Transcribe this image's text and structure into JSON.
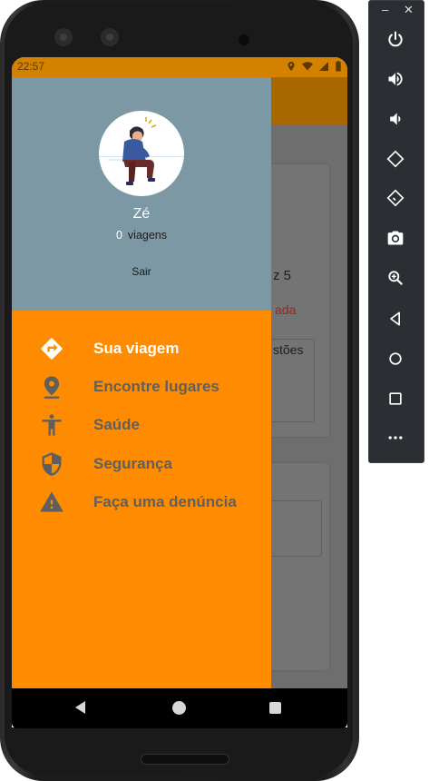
{
  "status_bar": {
    "time": "22:57"
  },
  "background_app": {
    "fragments": [
      "z 5",
      "ada",
      "stões"
    ]
  },
  "drawer": {
    "user_name": "Zé",
    "trip_count": "0",
    "trips_label": "viagens",
    "logout_label": "Sair",
    "menu": [
      {
        "label": "Sua viagem",
        "icon": "directions-icon",
        "active": true
      },
      {
        "label": "Encontre lugares",
        "icon": "location-pin-icon",
        "active": false
      },
      {
        "label": "Saúde",
        "icon": "accessibility-person-icon",
        "active": false
      },
      {
        "label": "Segurança",
        "icon": "shield-icon",
        "active": false
      },
      {
        "label": "Faça uma denúncia",
        "icon": "warning-icon",
        "active": false
      }
    ]
  },
  "colors": {
    "accent": "#ff8c00",
    "header": "#7b98a4",
    "status_bar": "#d38200",
    "active_label": "#ffffff",
    "inactive_label": "#5f5f5f"
  },
  "emulator_panel": {
    "controls": [
      "power-icon",
      "volume-up-icon",
      "volume-down-icon",
      "rotate-left-icon",
      "rotate-right-icon",
      "camera-icon",
      "zoom-icon",
      "back-icon",
      "home-icon",
      "overview-icon",
      "more-icon"
    ]
  }
}
